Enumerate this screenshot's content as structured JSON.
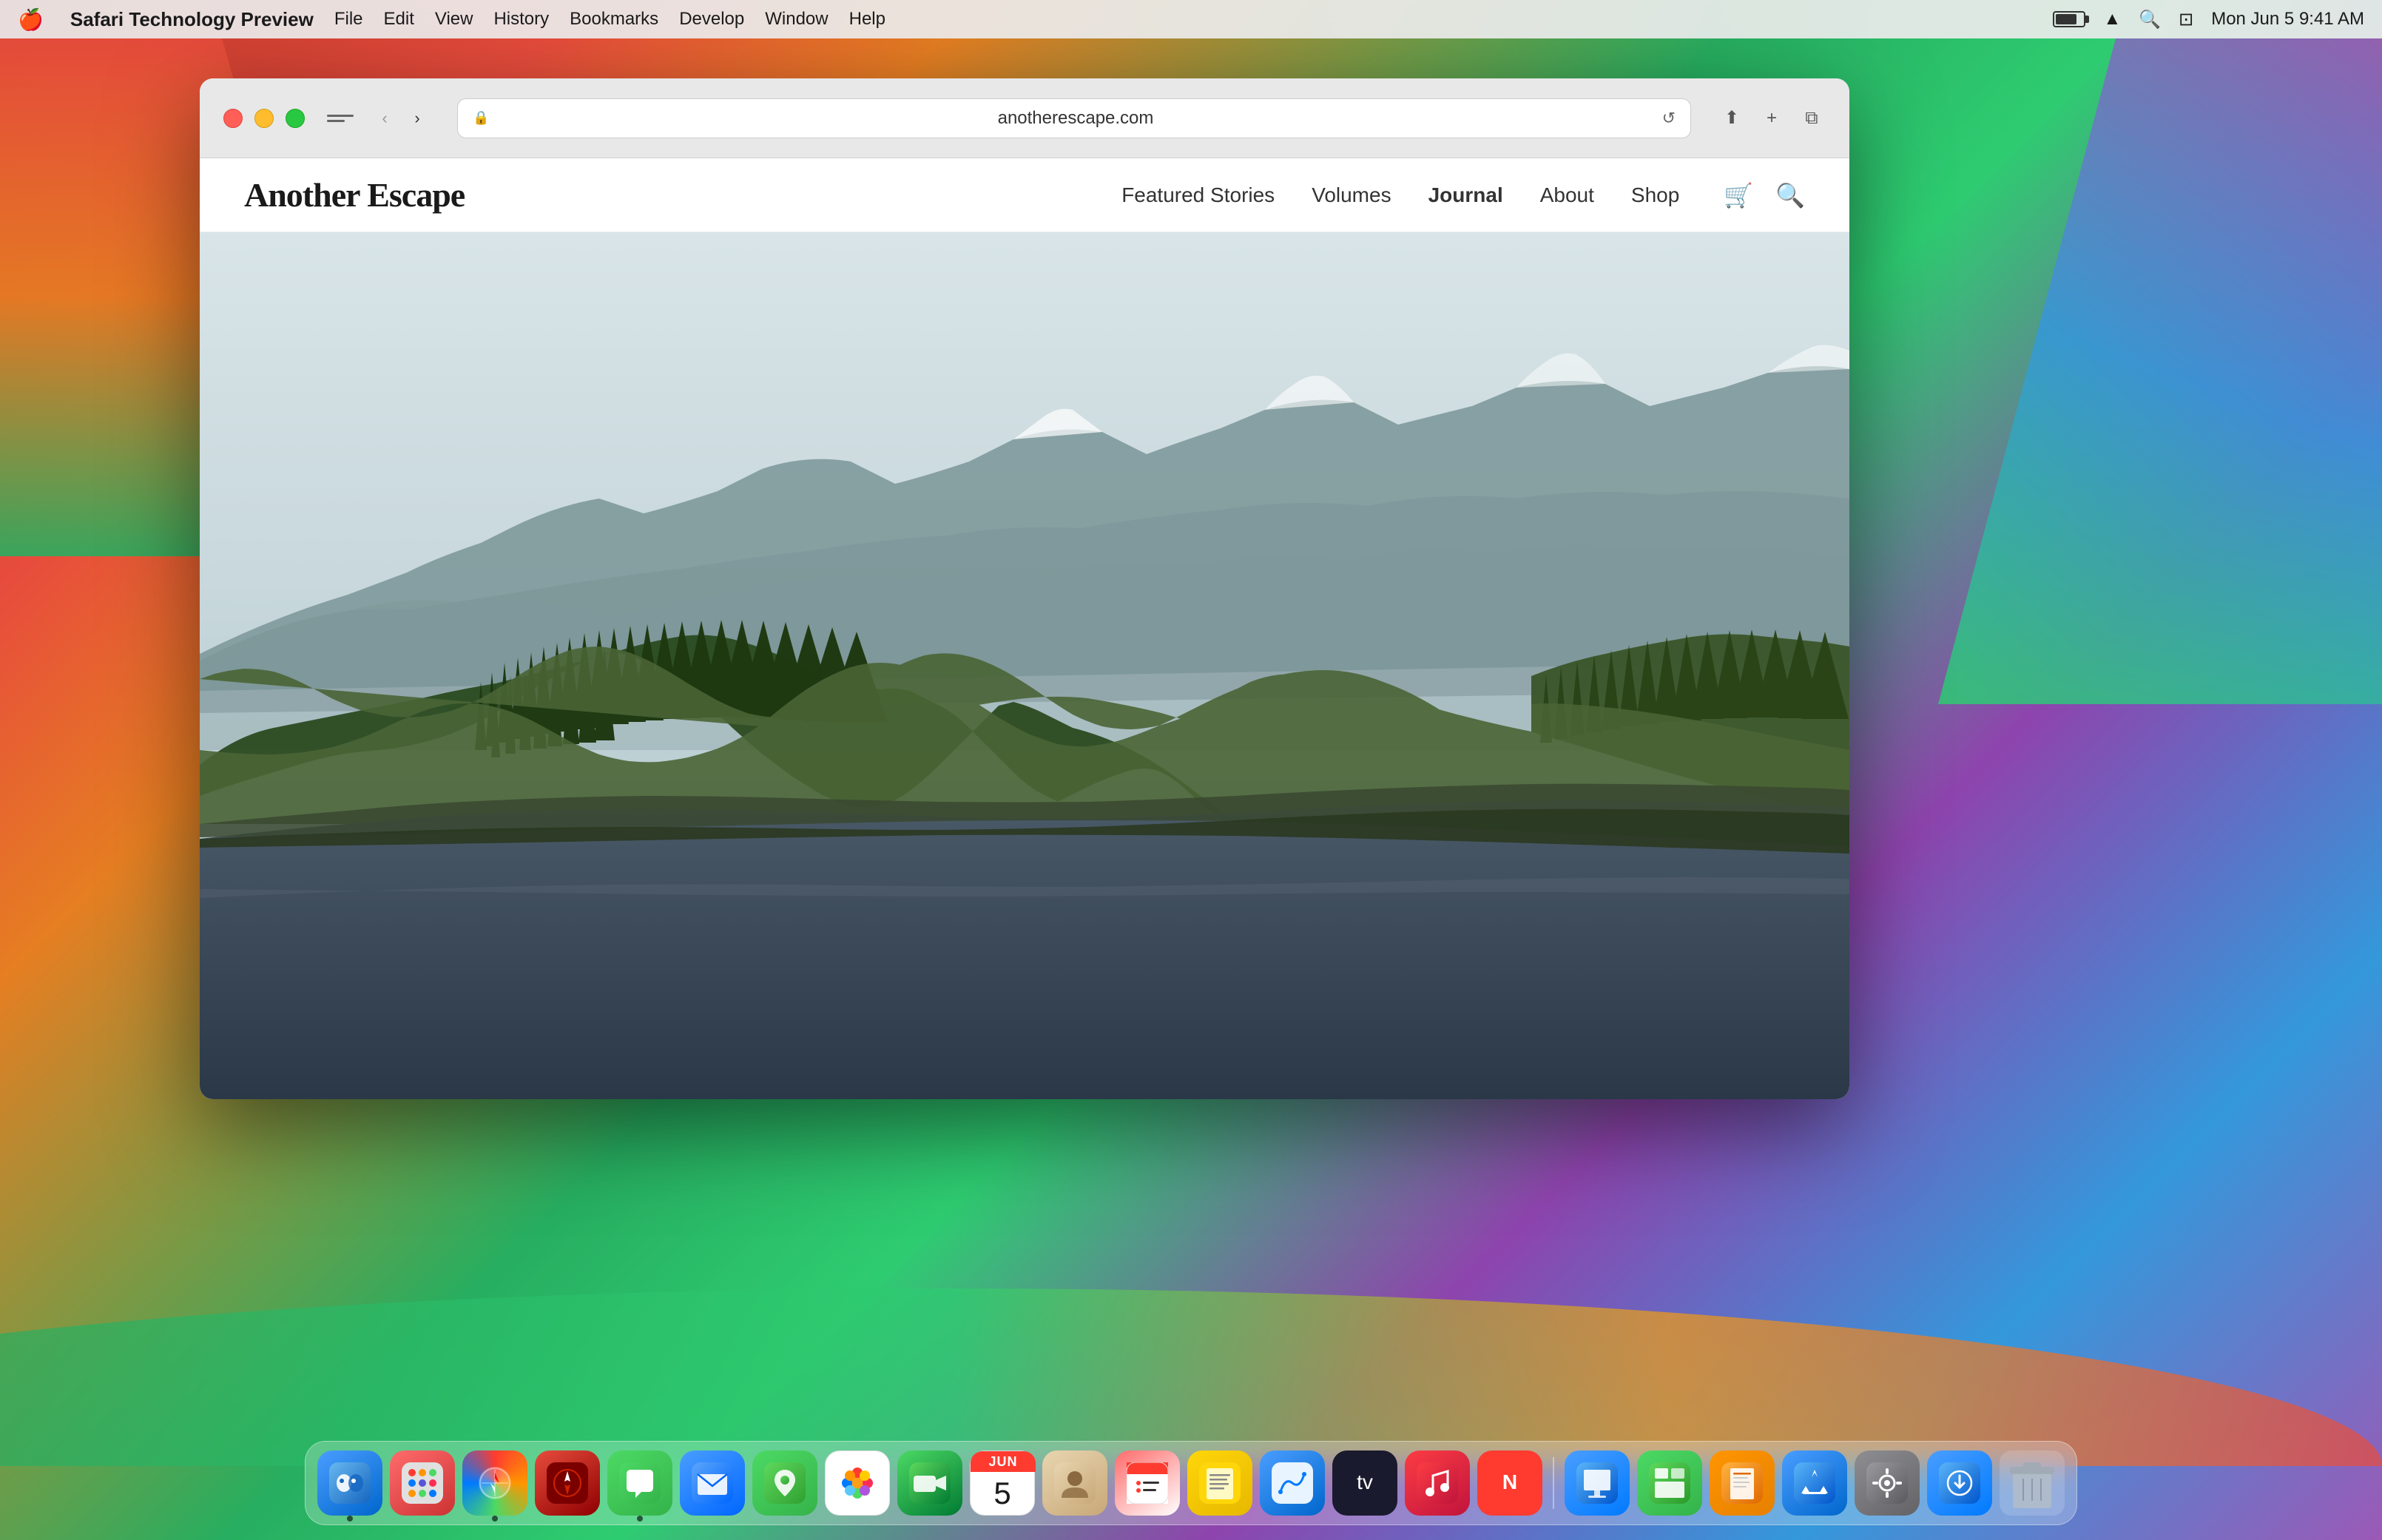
{
  "menubar": {
    "apple": "🍎",
    "app_name": "Safari Technology Preview",
    "items": [
      "File",
      "Edit",
      "View",
      "History",
      "Bookmarks",
      "Develop",
      "Window",
      "Help"
    ],
    "time": "Mon Jun 5  9:41 AM"
  },
  "browser": {
    "url": "anotherescape.com",
    "back_btn": "‹",
    "forward_btn": "›"
  },
  "website": {
    "logo": "Another Escape",
    "nav": {
      "items": [
        {
          "label": "Featured Stories",
          "active": false
        },
        {
          "label": "Volumes",
          "active": false
        },
        {
          "label": "Journal",
          "active": true
        },
        {
          "label": "About",
          "active": false
        },
        {
          "label": "Shop",
          "active": false
        }
      ]
    }
  },
  "dock": {
    "items": [
      {
        "name": "finder",
        "label": "Finder",
        "emoji": "😊",
        "class": "app-finder"
      },
      {
        "name": "launchpad",
        "label": "Launchpad",
        "emoji": "⊞",
        "class": "app-launchpad"
      },
      {
        "name": "safari",
        "label": "Safari",
        "emoji": "🧭",
        "class": "app-safari"
      },
      {
        "name": "compass",
        "label": "Compass",
        "emoji": "🎯",
        "class": "app-compass"
      },
      {
        "name": "messages",
        "label": "Messages",
        "emoji": "💬",
        "class": "app-messages"
      },
      {
        "name": "mail",
        "label": "Mail",
        "emoji": "✉",
        "class": "app-mail"
      },
      {
        "name": "maps",
        "label": "Maps",
        "emoji": "📍",
        "class": "app-maps"
      },
      {
        "name": "photos",
        "label": "Photos",
        "emoji": "🌸",
        "class": "app-photos"
      },
      {
        "name": "facetime",
        "label": "FaceTime",
        "emoji": "📹",
        "class": "app-facetime"
      },
      {
        "name": "calendar",
        "label": "Calendar",
        "month": "JUN",
        "day": "5",
        "class": "app-calendar"
      },
      {
        "name": "contacts",
        "label": "Contacts",
        "emoji": "👤",
        "class": "app-contacts"
      },
      {
        "name": "reminders",
        "label": "Reminders",
        "emoji": "☑",
        "class": "app-reminders"
      },
      {
        "name": "notes",
        "label": "Notes",
        "emoji": "📝",
        "class": "app-notes"
      },
      {
        "name": "freeform",
        "label": "Freeform",
        "emoji": "✏",
        "class": "app-freeform"
      },
      {
        "name": "appletv",
        "label": "Apple TV",
        "emoji": "📺",
        "class": "app-appletv"
      },
      {
        "name": "music",
        "label": "Music",
        "emoji": "♪",
        "class": "app-music"
      },
      {
        "name": "news",
        "label": "News",
        "emoji": "📰",
        "class": "app-news"
      },
      {
        "name": "keynote",
        "label": "Keynote",
        "emoji": "🎭",
        "class": "app-keynote"
      },
      {
        "name": "numbers",
        "label": "Numbers",
        "emoji": "📊",
        "class": "app-numbers"
      },
      {
        "name": "pages",
        "label": "Pages",
        "emoji": "📄",
        "class": "app-pages"
      },
      {
        "name": "appstore",
        "label": "App Store",
        "emoji": "A",
        "class": "app-appstore"
      },
      {
        "name": "systemprefs",
        "label": "System Preferences",
        "emoji": "⚙",
        "class": "app-systemprefs"
      },
      {
        "name": "airdrop",
        "label": "AirDrop",
        "emoji": "↓",
        "class": "app-airdrop"
      },
      {
        "name": "trash",
        "label": "Trash",
        "emoji": "🗑",
        "class": "app-trash"
      }
    ]
  }
}
